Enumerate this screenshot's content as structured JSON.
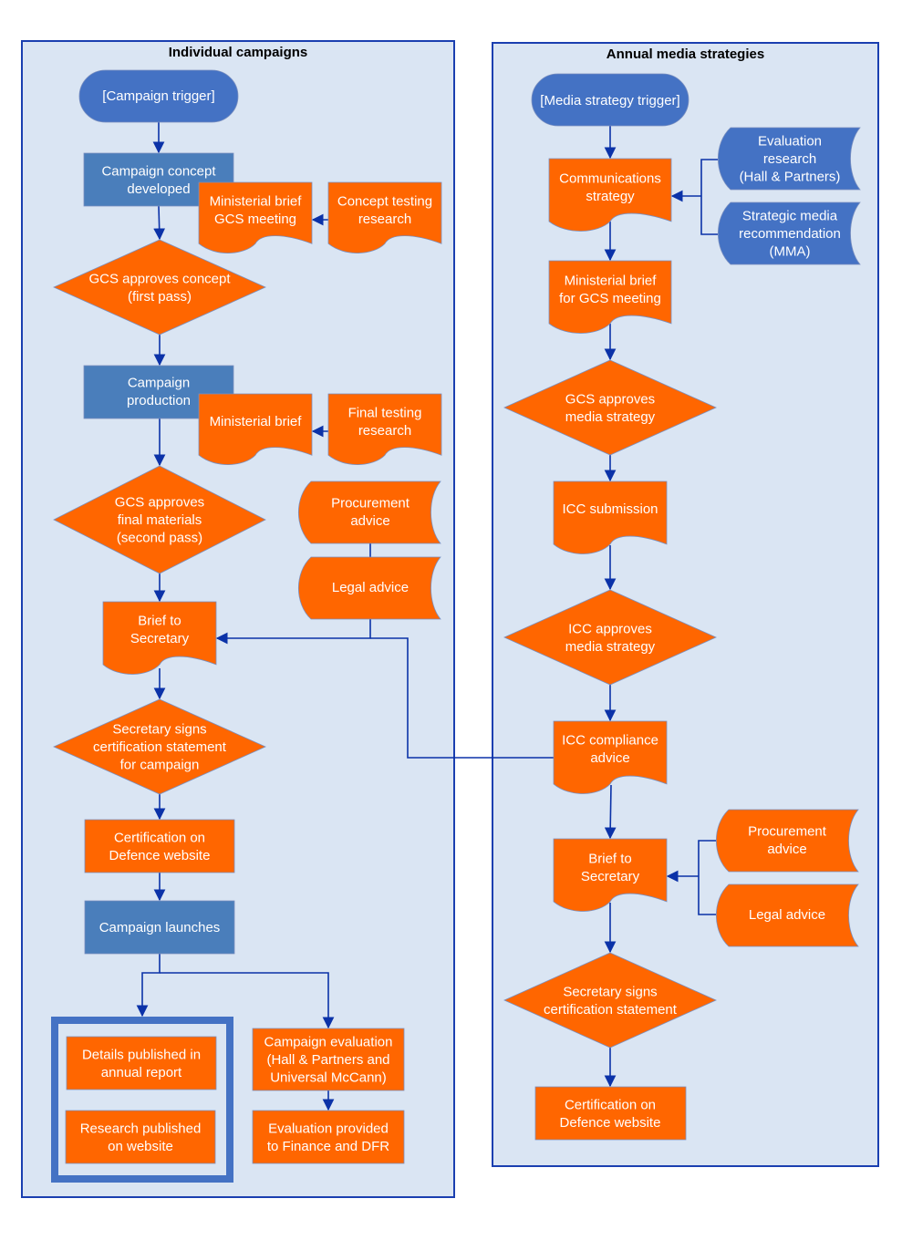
{
  "colors": {
    "panel_fill": "#dae5f3",
    "panel_border": "#1a3fb0",
    "orange": "#ff6600",
    "terminal_blue": "#4472c4",
    "process_blue": "#4a7ebb",
    "connector": "#0b32a8",
    "text_light": "#ffffff",
    "text_dark": "#000000"
  },
  "panels": {
    "left": {
      "title": "Individual campaigns"
    },
    "right": {
      "title": "Annual media strategies"
    }
  },
  "nodes": {
    "campaign_trigger": [
      "[Campaign trigger]"
    ],
    "campaign_concept": [
      "Campaign concept",
      "developed"
    ],
    "ministerial_brief_gcs": [
      "Ministerial brief",
      "GCS meeting"
    ],
    "concept_testing": [
      "Concept testing",
      "research"
    ],
    "gcs_approves_concept": [
      "GCS approves concept",
      "(first pass)"
    ],
    "campaign_production": [
      "Campaign",
      "production"
    ],
    "ministerial_brief": [
      "Ministerial brief"
    ],
    "final_testing": [
      "Final testing",
      "research"
    ],
    "gcs_approves_final": [
      "GCS approves",
      "final materials",
      "(second pass)"
    ],
    "procurement_left": [
      "Procurement",
      "advice"
    ],
    "legal_left": [
      "Legal advice"
    ],
    "brief_secretary_left": [
      "Brief to",
      "Secretary"
    ],
    "secretary_signs_campaign": [
      "Secretary signs",
      "certification statement",
      "for campaign"
    ],
    "certification_left": [
      "Certification on",
      "Defence website"
    ],
    "campaign_launches": [
      "Campaign launches"
    ],
    "details_published": [
      "Details published in",
      "annual report"
    ],
    "research_published": [
      "Research published",
      "on website"
    ],
    "campaign_evaluation": [
      "Campaign evaluation",
      "(Hall & Partners and",
      "Universal McCann)"
    ],
    "evaluation_provided": [
      "Evaluation provided",
      "to Finance and DFR"
    ],
    "media_trigger": [
      "[Media strategy trigger]"
    ],
    "comms_strategy": [
      "Communications",
      "strategy"
    ],
    "evaluation_research": [
      "Evaluation",
      "research",
      "(Hall & Partners)"
    ],
    "strategic_media": [
      "Strategic media",
      "recommendation",
      "(MMA)"
    ],
    "ministerial_brief_right": [
      "Ministerial brief",
      "for GCS meeting"
    ],
    "gcs_approves_media": [
      "GCS approves",
      "media strategy"
    ],
    "icc_submission": [
      "ICC submission"
    ],
    "icc_approves": [
      "ICC approves",
      "media strategy"
    ],
    "icc_compliance": [
      "ICC compliance",
      "advice"
    ],
    "brief_secretary_right": [
      "Brief to",
      "Secretary"
    ],
    "procurement_right": [
      "Procurement",
      "advice"
    ],
    "legal_right": [
      "Legal advice"
    ],
    "secretary_signs_right": [
      "Secretary signs",
      "certification statement"
    ],
    "certification_right": [
      "Certification on",
      "Defence website"
    ]
  }
}
